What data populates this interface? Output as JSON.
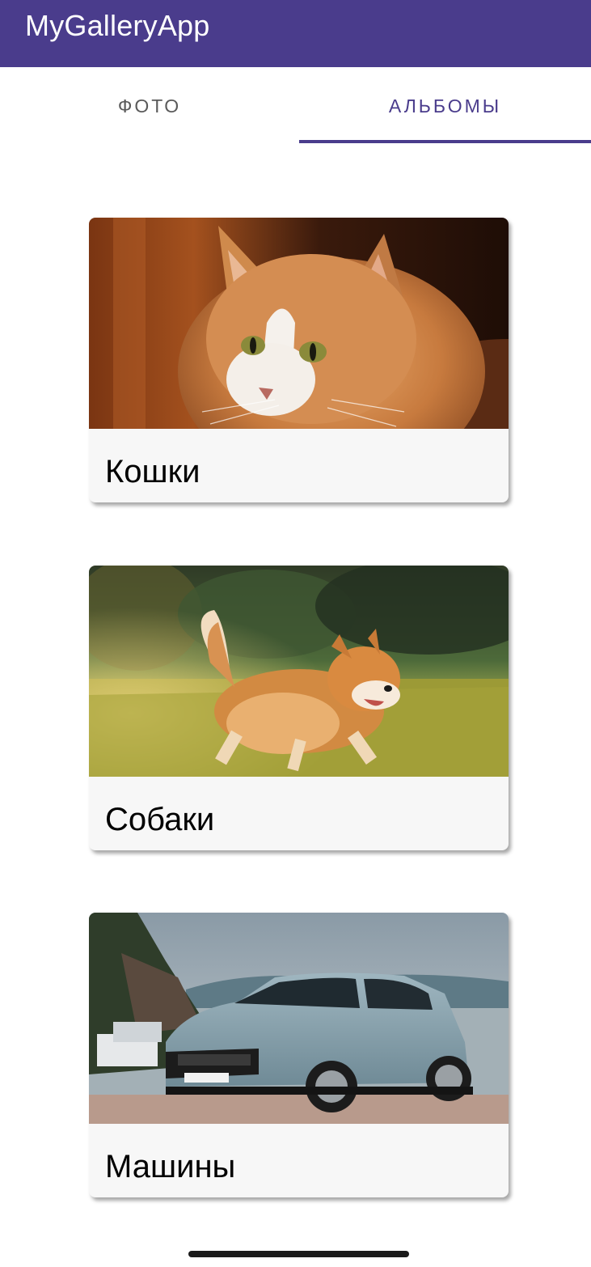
{
  "app": {
    "title": "MyGalleryApp",
    "accent_color": "#4a3c8c"
  },
  "tabs": [
    {
      "label": "ФОТО",
      "selected": false
    },
    {
      "label": "АЛЬБОМЫ",
      "selected": true
    }
  ],
  "albums": [
    {
      "title": "Кошки",
      "image": "cat-photo"
    },
    {
      "title": "Собаки",
      "image": "dog-photo"
    },
    {
      "title": "Машины",
      "image": "car-photo"
    }
  ]
}
